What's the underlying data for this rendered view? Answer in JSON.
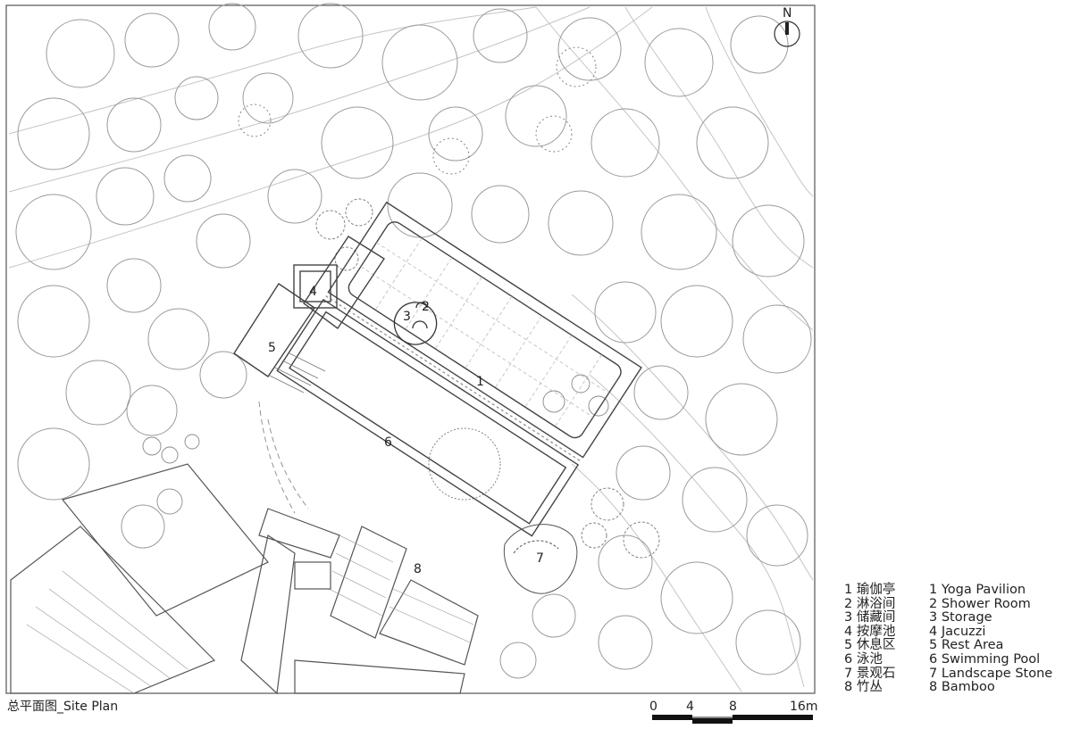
{
  "plan": {
    "north_label": "N",
    "zone_numbers": [
      "1",
      "2",
      "3",
      "4",
      "5",
      "6",
      "7",
      "8"
    ]
  },
  "legend": {
    "chinese": [
      "1 瑜伽亭",
      "2 淋浴间",
      "3 储藏间",
      "4 按摩池",
      "5 休息区",
      "6 泳池",
      "7 景观石",
      "8 竹丛"
    ],
    "english": [
      "1 Yoga Pavilion",
      "2 Shower Room",
      "3 Storage",
      "4 Jacuzzi",
      "5 Rest Area",
      "6 Swimming Pool",
      "7 Landscape Stone",
      "8 Bamboo"
    ]
  },
  "caption": "总平面图_Site Plan",
  "scale_bar": {
    "ticks": [
      "0",
      "4",
      "8",
      "16m"
    ]
  },
  "colors": {
    "line": "#555555",
    "light_line": "#bdbdbd",
    "ink": "#222222",
    "paper": "#ffffff"
  }
}
